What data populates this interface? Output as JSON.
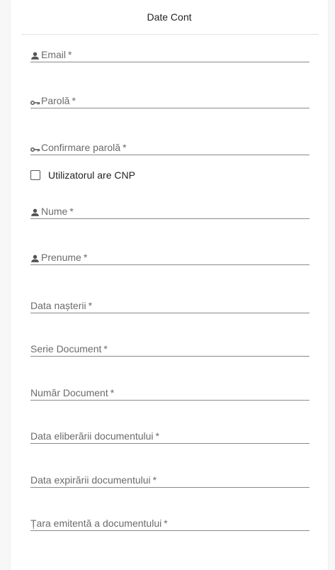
{
  "header": {
    "title": "Date Cont"
  },
  "fields": {
    "email": {
      "label": "Email",
      "required": "*",
      "icon": "person-icon"
    },
    "password": {
      "label": "Parolă",
      "required": "*",
      "icon": "key-icon"
    },
    "confirm_password": {
      "label": "Confirmare parolă",
      "required": "*",
      "icon": "key-icon"
    },
    "has_cnp": {
      "label": "Utilizatorul are CNP",
      "checked": false
    },
    "last_name": {
      "label": "Nume",
      "required": "*",
      "icon": "person-icon"
    },
    "first_name": {
      "label": "Prenume",
      "required": "*",
      "icon": "person-icon"
    },
    "birth_date": {
      "label": "Data nașterii",
      "required": "*"
    },
    "document_series": {
      "label": "Serie Document",
      "required": "*"
    },
    "document_number": {
      "label": "Număr Document",
      "required": "*"
    },
    "document_issue_date": {
      "label": "Data eliberării documentului",
      "required": "*"
    },
    "document_expiry_date": {
      "label": "Data expirării documentului",
      "required": "*"
    },
    "issuing_country": {
      "label": "Țara emitentă a documentului",
      "required": "*"
    }
  }
}
